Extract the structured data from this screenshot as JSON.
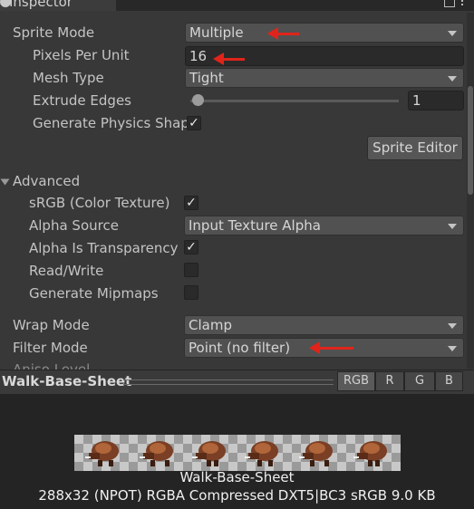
{
  "window": {
    "tab_title": "Inspector"
  },
  "sprite": {
    "mode_label": "Sprite Mode",
    "mode_value": "Multiple",
    "ppu_label": "Pixels Per Unit",
    "ppu_value": "16",
    "mesh_label": "Mesh Type",
    "mesh_value": "Tight",
    "extrude_label": "Extrude Edges",
    "extrude_value": "1",
    "extrude_slider": 0.0,
    "physics_label": "Generate Physics Shap",
    "physics_checked": "✓",
    "editor_button": "Sprite Editor"
  },
  "advanced": {
    "header": "Advanced",
    "srgb_label": "sRGB (Color Texture)",
    "srgb_checked": "✓",
    "alpha_source_label": "Alpha Source",
    "alpha_source_value": "Input Texture Alpha",
    "alpha_transp_label": "Alpha Is Transparency",
    "alpha_transp_checked": "✓",
    "readwrite_label": "Read/Write",
    "mipmaps_label": "Generate Mipmaps"
  },
  "wrap": {
    "label": "Wrap Mode",
    "value": "Clamp"
  },
  "filter": {
    "label": "Filter Mode",
    "value": "Point (no filter)"
  },
  "aniso": {
    "label": "Aniso Level"
  },
  "preview": {
    "title": "Walk-Base-Sheet",
    "channels": [
      "RGB",
      "R",
      "G",
      "B"
    ],
    "name": "Walk-Base-Sheet",
    "info": "288x32 (NPOT)  RGBA Compressed DXT5|BC3 sRGB   9.0 KB"
  },
  "colors": {
    "annotation_arrow": "#e0241b",
    "panel_bg": "#383838",
    "field_bg": "#515151"
  }
}
